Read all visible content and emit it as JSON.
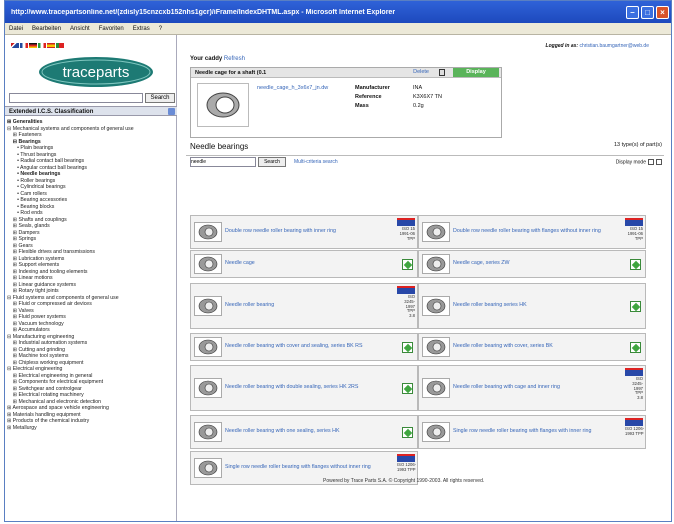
{
  "window": {
    "title": "http://www.tracepartsonline.net/(zdisly15cnzcxb152nhs1gcr)/iFrame/IndexDHTML.aspx - Microsoft Internet Explorer"
  },
  "menu": [
    "Datei",
    "Bearbeiten",
    "Ansicht",
    "Favoriten",
    "Extras",
    "?"
  ],
  "left": {
    "logo": "traceparts",
    "search_button": "Search",
    "classification_title": "Extended I.C.S. Classification",
    "tree": [
      {
        "t": "⊞ Generalities",
        "b": true
      },
      {
        "t": "⊟ Mechanical systems and components of general use",
        "b": false
      },
      {
        "t": "    ⊞ Fasteners",
        "b": false
      },
      {
        "t": "    ⊟ Bearings",
        "b": true
      },
      {
        "t": "       • Plain bearings",
        "b": false
      },
      {
        "t": "       • Thrust bearings",
        "b": false
      },
      {
        "t": "       • Radial contact ball bearings",
        "b": false
      },
      {
        "t": "       • Angular contact ball bearings",
        "b": false
      },
      {
        "t": "       • Needle bearings",
        "b": true
      },
      {
        "t": "       • Roller bearings",
        "b": false
      },
      {
        "t": "       • Cylindrical bearings",
        "b": false
      },
      {
        "t": "       • Cam rollers",
        "b": false
      },
      {
        "t": "       • Bearing accessories",
        "b": false
      },
      {
        "t": "       • Bearing blocks",
        "b": false
      },
      {
        "t": "       • Rod ends",
        "b": false
      },
      {
        "t": "    ⊞ Shafts and couplings",
        "b": false
      },
      {
        "t": "    ⊞ Seals, glands",
        "b": false
      },
      {
        "t": "    ⊞ Dampers",
        "b": false
      },
      {
        "t": "    ⊞ Springs",
        "b": false
      },
      {
        "t": "    ⊞ Gears",
        "b": false
      },
      {
        "t": "    ⊞ Flexible drives and transmissions",
        "b": false
      },
      {
        "t": "    ⊞ Lubrication systems",
        "b": false
      },
      {
        "t": "    ⊞ Support elements",
        "b": false
      },
      {
        "t": "    ⊞ Indexing and tooling elements",
        "b": false
      },
      {
        "t": "    ⊞ Linear motions",
        "b": false
      },
      {
        "t": "    ⊞ Linear guidance systems",
        "b": false
      },
      {
        "t": "    ⊞ Rotary tight joints",
        "b": false
      },
      {
        "t": "⊟ Fluid systems and components of general use",
        "b": false
      },
      {
        "t": "    ⊞ Fluid or compressed air devices",
        "b": false
      },
      {
        "t": "    ⊞ Valves",
        "b": false
      },
      {
        "t": "    ⊞ Fluid power systems",
        "b": false
      },
      {
        "t": "    ⊞ Vacuum technology",
        "b": false
      },
      {
        "t": "    ⊞ Accumulators",
        "b": false
      },
      {
        "t": "⊟ Manufacturing engineering",
        "b": false
      },
      {
        "t": "    ⊞ Industrial automation systems",
        "b": false
      },
      {
        "t": "    ⊞ Cutting and grinding",
        "b": false
      },
      {
        "t": "    ⊞ Machine tool systems",
        "b": false
      },
      {
        "t": "    ⊞ Chipless working equipment",
        "b": false
      },
      {
        "t": "⊟ Electrical engineering",
        "b": false
      },
      {
        "t": "    ⊞ Electrical engineering in general",
        "b": false
      },
      {
        "t": "    ⊞ Components for electrical equipment",
        "b": false
      },
      {
        "t": "    ⊞ Switchgear and controlgear",
        "b": false
      },
      {
        "t": "    ⊞ Electrical rotating machinery",
        "b": false
      },
      {
        "t": "    ⊞ Mechanical and electronic detection",
        "b": false
      },
      {
        "t": "⊞ Aerospace and space vehicle engineering",
        "b": false
      },
      {
        "t": "⊞ Materials handling equipment",
        "b": false
      },
      {
        "t": "⊞ Products of the chemical industry",
        "b": false
      },
      {
        "t": "⊞ Metallurgy",
        "b": false
      }
    ]
  },
  "main": {
    "logged_label": "Logged in as:",
    "logged_user": "christian.baumgartner@web.de",
    "caddy_title": "Your caddy",
    "caddy_link": "Refresh",
    "caddy": {
      "header": "Needle cage for a shaft (0.1",
      "delete": "Delete",
      "display": "Display",
      "file": "needle_cage_h_3x6x7_jn.dw",
      "rows": [
        {
          "k": "Manufacturer",
          "v": "INA"
        },
        {
          "k": "Reference",
          "v": "K3X6X7 TN"
        },
        {
          "k": "Mass",
          "v": "0.2g"
        }
      ]
    },
    "section_title": "Needle bearings",
    "section_count": "13 type(s) of part(s)",
    "filter_value": "needle",
    "filter_button": "Search",
    "multi_search": "Multi-criteria search",
    "display_mode": "Display mode",
    "cards": [
      {
        "label": "Double row needle roller bearing with inner ring",
        "badge": "SKF",
        "info": "ISO 15\n1991-06\nTPP"
      },
      {
        "label": "Double row needle roller bearing with flanges without inner ring",
        "badge": "SKF",
        "info": "ISO 15\n1991-06\nTPP"
      },
      {
        "label": "Needle cage",
        "badge": "",
        "info": ""
      },
      {
        "label": "Needle cage, series ZW",
        "badge": "",
        "info": ""
      },
      {
        "label": "Needle roller bearing",
        "badge": "SKF",
        "info": "ISO\n3245-\n1997\nTPP\n3.8"
      },
      {
        "label": "Needle roller bearing series HK",
        "badge": "",
        "info": ""
      },
      {
        "label": "Needle roller bearing with cover and sealing, series BK RS",
        "badge": "",
        "info": ""
      },
      {
        "label": "Needle roller bearing with cover, series BK",
        "badge": "",
        "info": ""
      },
      {
        "label": "Needle roller bearing with double sealing, series HK 2RS",
        "badge": "",
        "info": ""
      },
      {
        "label": "Needle roller bearing with cage and inner ring",
        "badge": "SKF",
        "info": "ISO\n3245-\n1997\nTPP\n3.8"
      },
      {
        "label": "Needle roller bearing with one sealing, series HK",
        "badge": "",
        "info": ""
      },
      {
        "label": "Single row needle roller bearing with flanges with inner ring",
        "badge": "SKF",
        "info": "ISO 1206-\n1993 TPP"
      },
      {
        "label": "Single row needle roller bearing with flanges without inner ring",
        "badge": "SKF",
        "info": "ISO 1206-\n1993 TPP"
      }
    ],
    "footer": "Powered by Trace Parts S.A. © Copyright 1990-2003. All rights reserved."
  },
  "colors": {
    "link": "#3565b8",
    "titlebar": "#1d49bd",
    "display_button": "#5ab45a"
  }
}
